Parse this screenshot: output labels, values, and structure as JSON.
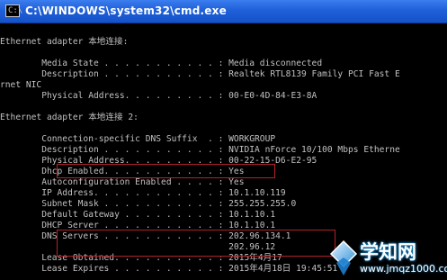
{
  "window": {
    "title": "C:\\WINDOWS\\system32\\cmd.exe",
    "icon_glyph": "C:\\"
  },
  "console": {
    "lines": [
      "",
      "Ethernet adapter 本地连接:",
      "",
      "        Media State . . . . . . . . . . . : Media disconnected",
      "        Description . . . . . . . . . . . : Realtek RTL8139 Family PCI Fast E",
      "rnet NIC",
      "        Physical Address. . . . . . . . . : 00-E0-4D-84-E3-8A",
      "",
      "Ethernet adapter 本地连接 2:",
      "",
      "        Connection-specific DNS Suffix  . : WORKGROUP",
      "        Description . . . . . . . . . . . : NVIDIA nForce 10/100 Mbps Etherne",
      "        Physical Address. . . . . . . . . : 00-22-15-D6-E2-95",
      "        Dhcp Enabled. . . . . . . . . . . : Yes",
      "        Autoconfiguration Enabled . . . . : Yes",
      "        IP Address. . . . . . . . . . . . : 10.1.10.119",
      "        Subnet Mask . . . . . . . . . . . : 255.255.255.0",
      "        Default Gateway . . . . . . . . . : 10.1.10.1",
      "        DHCP Server . . . . . . . . . . . : 10.1.10.1",
      "        DNS Servers . . . . . . . . . . . : 202.96.134.1",
      "                                            202.96.12",
      "        Lease Obtained. . . . . . . . . . : 2015年4月17",
      "        Lease Expires . . . . . . . . . . : 2015年4月18日 19:45:51"
    ]
  },
  "watermark": {
    "name": "学知网",
    "url": "www.jmqz1000.com"
  },
  "colors": {
    "console_text": "#c0c0c0",
    "highlight": "#b3212a",
    "titlebar": "#1f5fd8"
  }
}
